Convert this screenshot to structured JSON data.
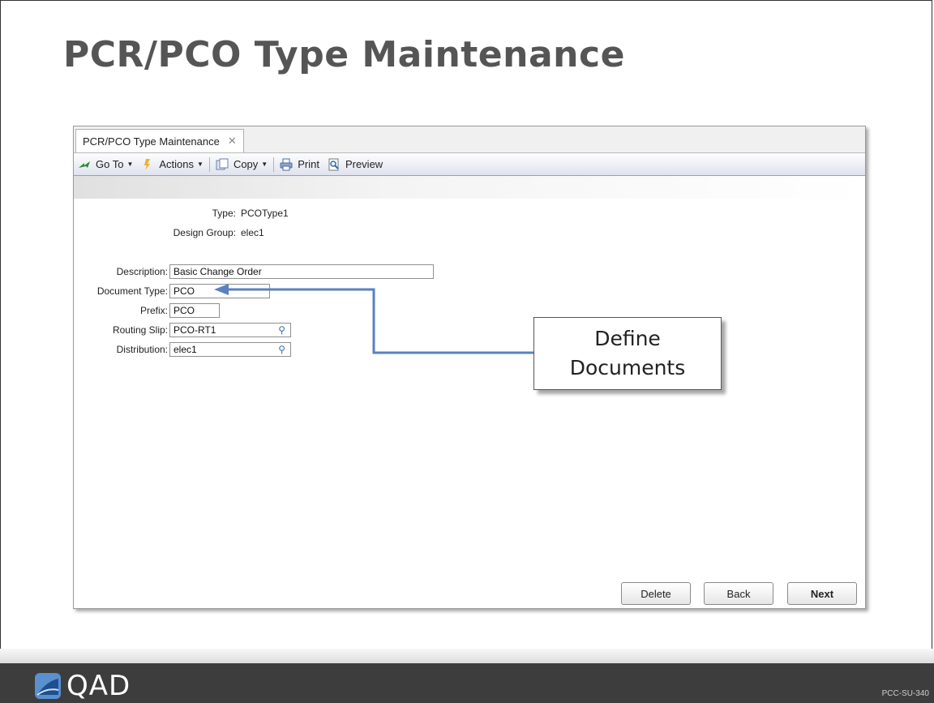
{
  "slide": {
    "title": "PCR/PCO Type Maintenance",
    "code": "PCC-SU-340",
    "logo_text": "QAD"
  },
  "window": {
    "tab_label": "PCR/PCO Type Maintenance",
    "tab_close": "✕",
    "toolbar": {
      "goto": "Go To",
      "actions": "Actions",
      "copy": "Copy",
      "print": "Print",
      "preview": "Preview"
    },
    "info": {
      "type_label": "Type:",
      "type_value": "PCOType1",
      "design_group_label": "Design Group:",
      "design_group_value": "elec1"
    },
    "form": {
      "description_label": "Description:",
      "description_value": "Basic Change Order",
      "document_type_label": "Document Type:",
      "document_type_value": "PCO",
      "prefix_label": "Prefix:",
      "prefix_value": "PCO",
      "routing_slip_label": "Routing Slip:",
      "routing_slip_value": "PCO-RT1",
      "distribution_label": "Distribution:",
      "distribution_value": "elec1"
    },
    "buttons": {
      "delete": "Delete",
      "back": "Back",
      "next": "Next"
    }
  },
  "callout": {
    "line1": "Define",
    "line2": "Documents"
  },
  "colors": {
    "arrow": "#5b82c0",
    "title": "#555555",
    "footer": "#3d3d3d"
  }
}
